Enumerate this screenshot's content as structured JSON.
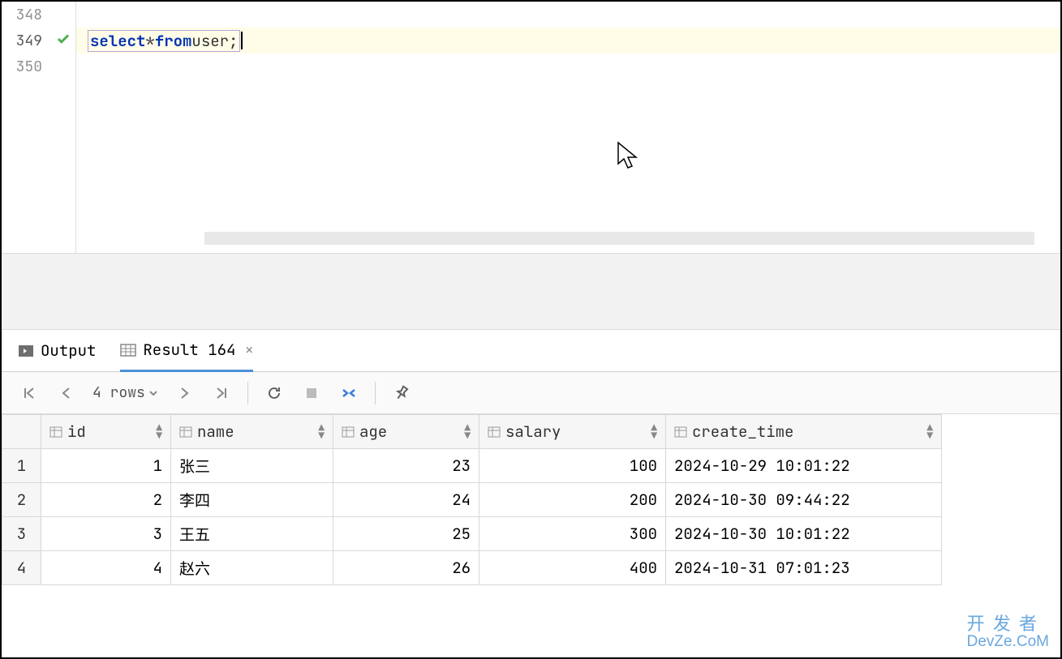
{
  "editor": {
    "lines": [
      {
        "number": "348",
        "active": false,
        "hasCheck": false
      },
      {
        "number": "349",
        "active": true,
        "hasCheck": true
      },
      {
        "number": "350",
        "active": false,
        "hasCheck": false
      }
    ],
    "sql": {
      "kw1": "select",
      "star": " * ",
      "kw2": "from",
      "table": " user",
      "semi": ";"
    }
  },
  "tabs": {
    "output": "Output",
    "result": "Result 164"
  },
  "toolbar": {
    "rows": "4 rows"
  },
  "columns": [
    "id",
    "name",
    "age",
    "salary",
    "create_time"
  ],
  "rows": [
    {
      "n": "1",
      "id": "1",
      "name": "张三",
      "age": "23",
      "salary": "100",
      "create_time": "2024-10-29 10:01:22"
    },
    {
      "n": "2",
      "id": "2",
      "name": "李四",
      "age": "24",
      "salary": "200",
      "create_time": "2024-10-30 09:44:22"
    },
    {
      "n": "3",
      "id": "3",
      "name": "王五",
      "age": "25",
      "salary": "300",
      "create_time": "2024-10-30 10:01:22"
    },
    {
      "n": "4",
      "id": "4",
      "name": "赵六",
      "age": "26",
      "salary": "400",
      "create_time": "2024-10-31 07:01:23"
    }
  ],
  "watermark": {
    "line1": "开 发 者",
    "line2": "DevZe.CoM"
  }
}
